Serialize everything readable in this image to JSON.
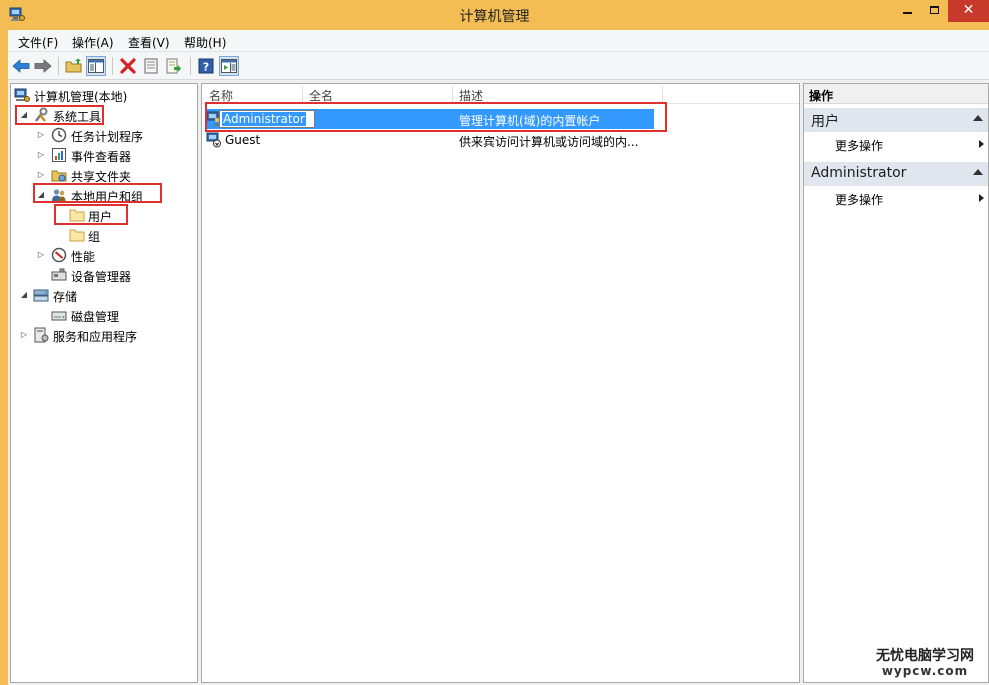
{
  "window": {
    "title": "计算机管理",
    "close_glyph": "✕"
  },
  "menu": [
    "文件(F)",
    "操作(A)",
    "查看(V)",
    "帮助(H)"
  ],
  "toolbar": {
    "icons": [
      "back-icon",
      "forward-icon",
      "up-folder-icon",
      "show-hide-tree-icon",
      "delete-icon",
      "properties-icon",
      "export-list-icon",
      "help-icon",
      "show-hide-action-pane-icon"
    ]
  },
  "tree": {
    "root": "计算机管理(本地)",
    "system_tools": "系统工具",
    "task_scheduler": "任务计划程序",
    "event_viewer": "事件查看器",
    "shared_folders": "共享文件夹",
    "local_users_groups": "本地用户和组",
    "users": "用户",
    "groups": "组",
    "performance": "性能",
    "device_manager": "设备管理器",
    "storage": "存储",
    "disk_management": "磁盘管理",
    "services_apps": "服务和应用程序"
  },
  "list": {
    "columns": [
      "名称",
      "全名",
      "描述"
    ],
    "rows": [
      {
        "name": "Administrator",
        "fullname": "",
        "description": "管理计算机(域)的内置帐户"
      },
      {
        "name": "Guest",
        "fullname": "",
        "description": "供来宾访问计算机或访问域的内..."
      }
    ]
  },
  "actions": {
    "header": "操作",
    "sections": [
      {
        "title": "用户",
        "item": "更多操作"
      },
      {
        "title": "Administrator",
        "item": "更多操作"
      }
    ]
  },
  "watermark": {
    "line1": "无忧电脑学习网",
    "line2": "wypcw.com"
  },
  "colors": {
    "title_bar": "#f3bd54",
    "selection": "#3399ff",
    "highlight_box": "#e02f2f",
    "close_button": "#c7392b"
  }
}
